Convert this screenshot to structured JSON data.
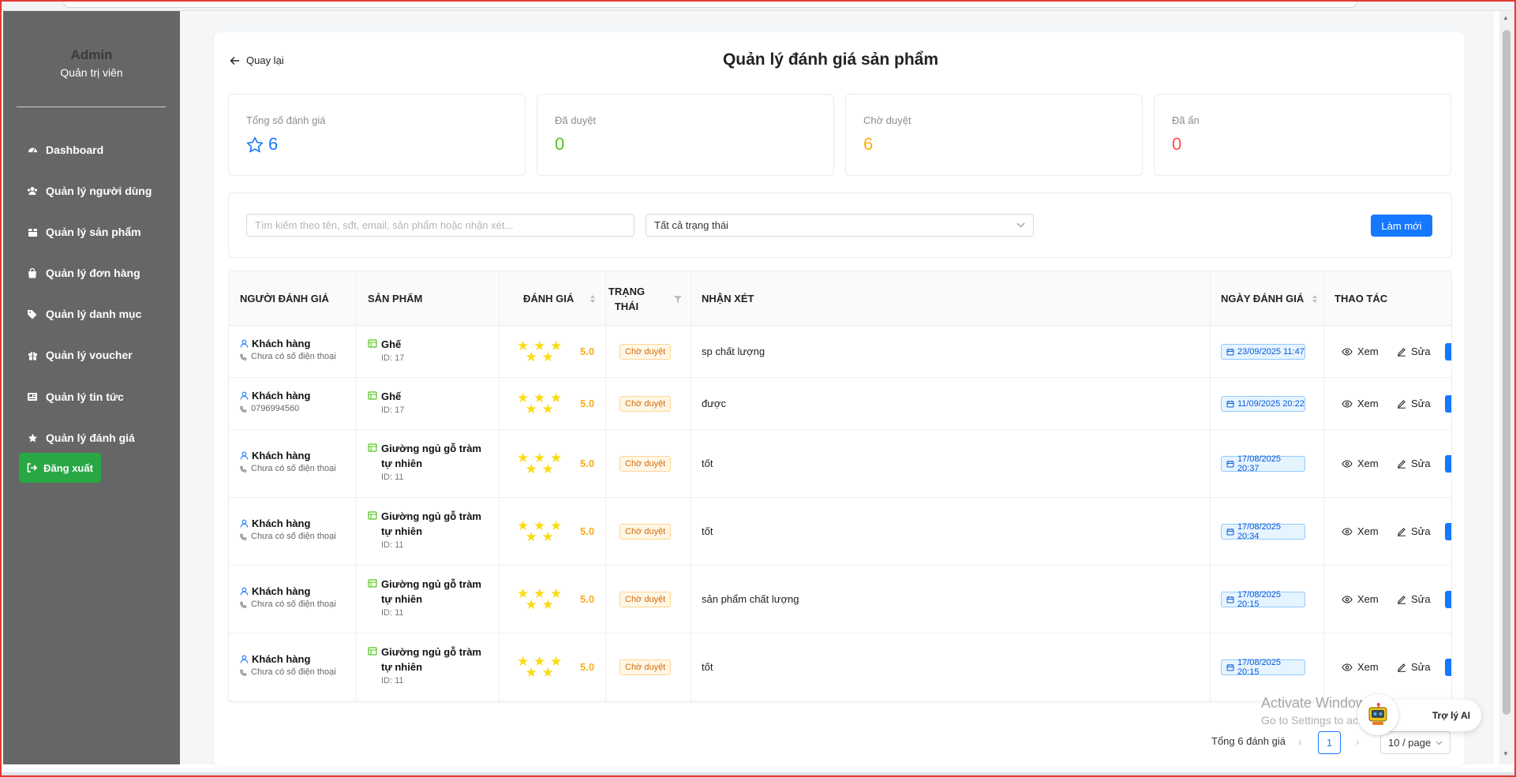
{
  "sidebar": {
    "admin_name": "Admin",
    "admin_role": "Quản trị viên",
    "items": [
      {
        "label": "Dashboard",
        "icon": "dashboard-icon"
      },
      {
        "label": "Quản lý người dùng",
        "icon": "users-icon"
      },
      {
        "label": "Quản lý sản phẩm",
        "icon": "box-icon"
      },
      {
        "label": "Quản lý đơn hàng",
        "icon": "shopping-bag-icon"
      },
      {
        "label": "Quản lý danh mục",
        "icon": "tags-icon"
      },
      {
        "label": "Quản lý voucher",
        "icon": "gift-icon"
      },
      {
        "label": "Quản lý tin tức",
        "icon": "newspaper-icon"
      },
      {
        "label": "Quản lý đánh giá",
        "icon": "star-icon"
      }
    ],
    "logout_label": "Đăng xuất"
  },
  "header": {
    "back_label": "Quay lại",
    "title": "Quản lý đánh giá sản phẩm"
  },
  "stats": [
    {
      "label": "Tổng số đánh giá",
      "value": "6",
      "color": "#1677ff"
    },
    {
      "label": "Đã duyệt",
      "value": "0",
      "color": "#52c41a"
    },
    {
      "label": "Chờ duyệt",
      "value": "6",
      "color": "#faad14"
    },
    {
      "label": "Đã ẩn",
      "value": "0",
      "color": "#ff4d4f"
    }
  ],
  "filters": {
    "search_placeholder": "Tìm kiếm theo tên, sđt, email, sản phẩm hoặc nhận xét...",
    "status_value": "Tất cả trạng thái",
    "refresh_label": "Làm mới"
  },
  "table": {
    "headers": {
      "reviewer": "NGƯỜI ĐÁNH GIÁ",
      "product": "SẢN PHẨM",
      "rating": "ĐÁNH GIÁ",
      "status_line1": "TRẠNG",
      "status_line2": "THÁI",
      "comment": "NHẬN XÉT",
      "date": "NGÀY ĐÁNH GIÁ",
      "actions": "THAO TÁC"
    },
    "view_label": "Xem",
    "edit_label": "Sửa",
    "rows": [
      {
        "name": "Khách hàng",
        "phone": "Chưa có số điện thoại",
        "product": "Ghế",
        "product_id": "ID: 17",
        "rating": "5.0",
        "stars": 5,
        "status": "Chờ duyệt",
        "comment": "sp chất lượng",
        "date": "23/09/2025 11:47"
      },
      {
        "name": "Khách hàng",
        "phone": "0796994560",
        "product": "Ghế",
        "product_id": "ID: 17",
        "rating": "5.0",
        "stars": 5,
        "status": "Chờ duyệt",
        "comment": "được",
        "date": "11/09/2025 20:22"
      },
      {
        "name": "Khách hàng",
        "phone": "Chưa có số điện thoại",
        "product": "Giường ngủ gỗ tràm tự nhiên",
        "product_id": "ID: 11",
        "rating": "5.0",
        "stars": 5,
        "status": "Chờ duyệt",
        "comment": "tốt",
        "date": "17/08/2025 20:37"
      },
      {
        "name": "Khách hàng",
        "phone": "Chưa có số điện thoại",
        "product": "Giường ngủ gỗ tràm tự nhiên",
        "product_id": "ID: 11",
        "rating": "5.0",
        "stars": 5,
        "status": "Chờ duyệt",
        "comment": "tốt",
        "date": "17/08/2025 20:34"
      },
      {
        "name": "Khách hàng",
        "phone": "Chưa có số điện thoại",
        "product": "Giường ngủ gỗ tràm tự nhiên",
        "product_id": "ID: 11",
        "rating": "5.0",
        "stars": 5,
        "status": "Chờ duyệt",
        "comment": "sản phẩm chất lượng",
        "date": "17/08/2025 20:15"
      },
      {
        "name": "Khách hàng",
        "phone": "Chưa có số điện thoại",
        "product": "Giường ngủ gỗ tràm tự nhiên",
        "product_id": "ID: 11",
        "rating": "5.0",
        "stars": 5,
        "status": "Chờ duyệt",
        "comment": "tốt",
        "date": "17/08/2025 20:15"
      }
    ]
  },
  "pagination": {
    "total_text": "Tổng 6 đánh giá",
    "prev": "‹",
    "current": "1",
    "next": "›",
    "page_size": "10 / page"
  },
  "overlay": {
    "watermark_line1": "Activate Windows",
    "watermark_line2": "Go to Settings to activate Windows.",
    "ai_label": "Trợ lý AI"
  }
}
